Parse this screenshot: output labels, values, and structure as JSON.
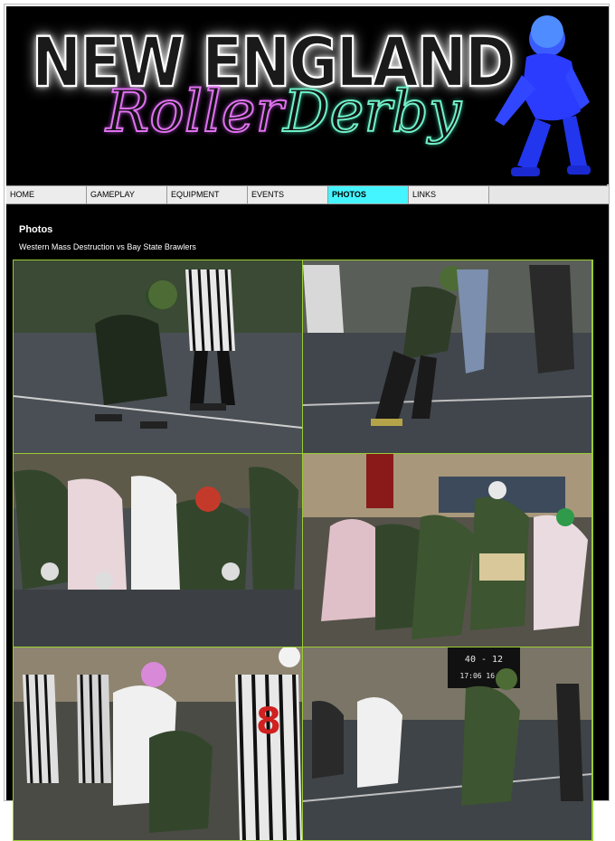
{
  "banner": {
    "title_main": "NEW ENGLAND",
    "title_script_1": "Roller",
    "title_script_2": "Derby"
  },
  "nav": {
    "items": [
      {
        "label": "HOME",
        "active": false
      },
      {
        "label": "GAMEPLAY",
        "active": false
      },
      {
        "label": "EQUIPMENT",
        "active": false
      },
      {
        "label": "EVENTS",
        "active": false
      },
      {
        "label": "PHOTOS",
        "active": true
      },
      {
        "label": "LINKS",
        "active": false
      }
    ]
  },
  "page": {
    "title": "Photos",
    "subtitle": "Western Mass Destruction vs Bay State Brawlers"
  },
  "colors": {
    "nav_active": "#44f4ff",
    "photo_border": "#9acd32",
    "script_pink": "#e070f0",
    "script_teal": "#70f0c8"
  },
  "photos": {
    "scoreboard_top": "40 - 12",
    "scoreboard_bottom": "17:06 16:40",
    "jersey_number": "8"
  }
}
